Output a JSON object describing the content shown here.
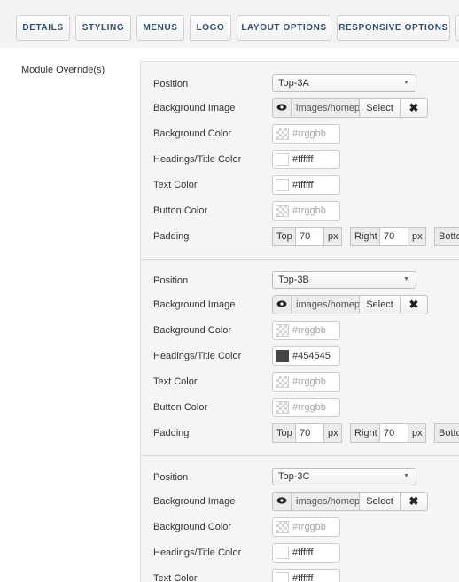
{
  "tabs": [
    "DETAILS",
    "STYLING",
    "MENUS",
    "LOGO",
    "LAYOUT OPTIONS",
    "RESPONSIVE OPTIONS"
  ],
  "side_label": "Module Override(s)",
  "labels": {
    "position": "Position",
    "background_image": "Background Image",
    "background_color": "Background Color",
    "headings_color": "Headings/Title Color",
    "text_color": "Text Color",
    "button_color": "Button Color",
    "padding": "Padding"
  },
  "media": {
    "select_label": "Select",
    "clear_icon": "close-icon",
    "preview_icon": "eye-icon"
  },
  "padding_labels": {
    "top": "Top",
    "right": "Right",
    "bottom": "Bottom",
    "unit": "px"
  },
  "placeholder_color": "#rrggbb",
  "sections": [
    {
      "position": "Top-3A",
      "bg_image": "images/homepage",
      "bg_color": "",
      "headings_color": "#ffffff",
      "text_color": "#ffffff",
      "button_color": "",
      "padding_top": "70",
      "padding_right": "70"
    },
    {
      "position": "Top-3B",
      "bg_image": "images/homepage",
      "bg_color": "",
      "headings_color": "#454545",
      "text_color": "",
      "button_color": "",
      "padding_top": "70",
      "padding_right": "70"
    },
    {
      "position": "Top-3C",
      "bg_image": "images/homepage",
      "bg_color": "",
      "headings_color": "#ffffff",
      "text_color": "#ffffff"
    }
  ]
}
